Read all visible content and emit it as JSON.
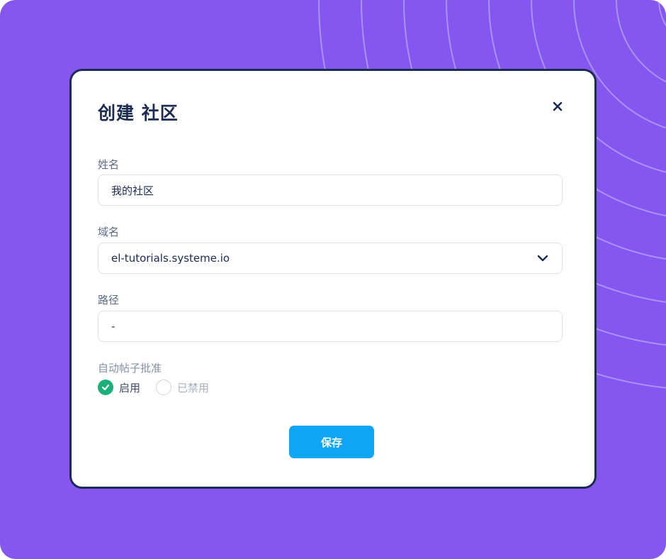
{
  "modal": {
    "title": "创建 社区",
    "close_icon": "close-icon"
  },
  "form": {
    "name": {
      "label": "姓名",
      "value": "我的社区"
    },
    "domain": {
      "label": "域名",
      "value": "el-tutorials.systeme.io",
      "icon": "chevron-down-icon"
    },
    "path": {
      "label": "路径",
      "value": "-"
    },
    "auto_approve": {
      "label": "自动帖子批准",
      "options": [
        {
          "label": "启用",
          "selected": true
        },
        {
          "label": "已禁用",
          "selected": false
        }
      ]
    },
    "save_label": "保存"
  },
  "colors": {
    "background": "#8556f0",
    "modal_border": "#1b2b52",
    "primary_button": "#0ea5f5",
    "radio_selected": "#1bb07a"
  }
}
